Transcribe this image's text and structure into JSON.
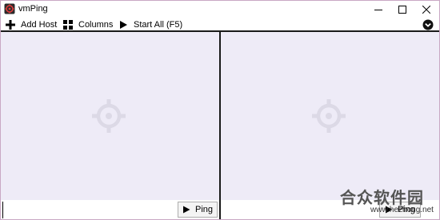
{
  "window": {
    "title": "vmPing"
  },
  "toolbar": {
    "add_host": "Add Host",
    "columns": "Columns",
    "start_all": "Start All (F5)"
  },
  "panes": [
    {
      "input_value": "",
      "ping_label": "Ping"
    },
    {
      "input_value": "",
      "ping_label": "Ping"
    }
  ],
  "watermark": {
    "brand": "合众软件园",
    "url": "www.hezhong.net"
  },
  "colors": {
    "pane_bg": "#eeebf7",
    "divider": "#1a1a1a",
    "window_border": "#c9a8c4"
  }
}
